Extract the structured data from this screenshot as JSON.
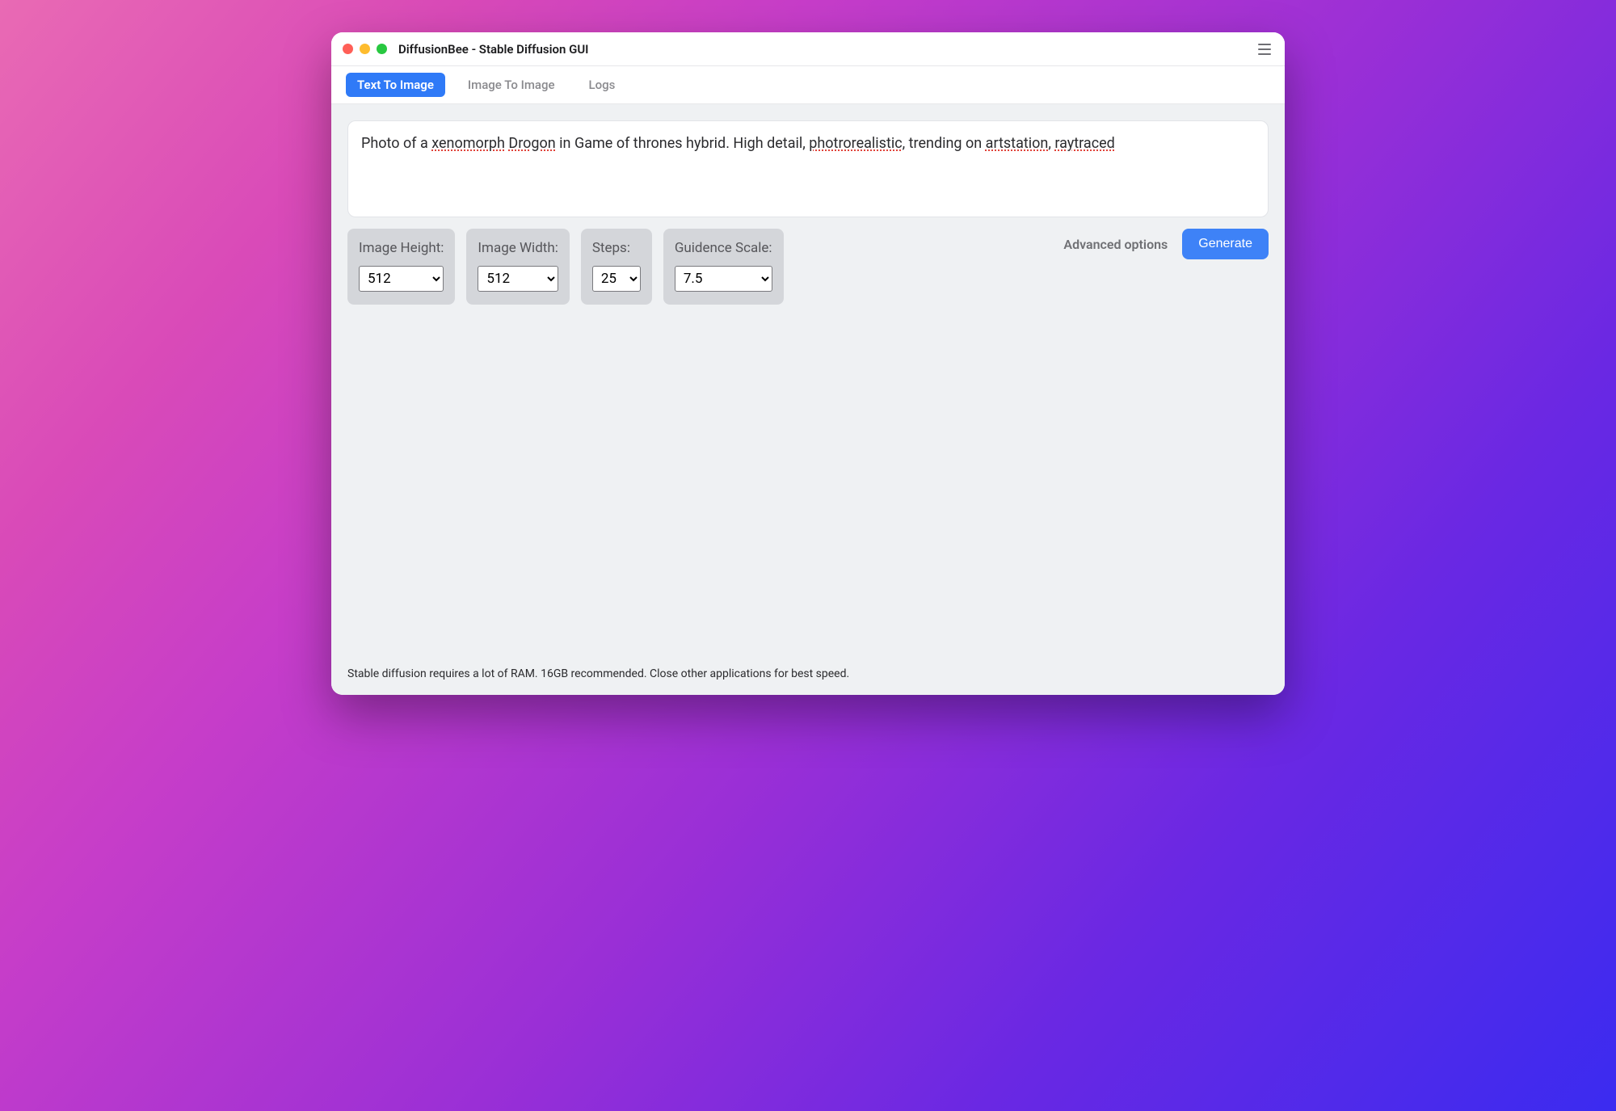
{
  "window": {
    "title": "DiffusionBee - Stable Diffusion GUI"
  },
  "tabs": {
    "text_to_image": "Text To Image",
    "image_to_image": "Image To Image",
    "logs": "Logs",
    "active": "text_to_image"
  },
  "prompt": {
    "value": "Photo of a xenomorph Drogon in Game of thrones hybrid. High detail, photrorealistic, trending on artstation, raytraced",
    "misspelled": [
      "xenomorph",
      "Drogon",
      "photrorealistic",
      "artstation",
      "raytraced"
    ]
  },
  "controls": {
    "image_height": {
      "label": "Image Height:",
      "value": "512"
    },
    "image_width": {
      "label": "Image Width:",
      "value": "512"
    },
    "steps": {
      "label": "Steps:",
      "value": "25"
    },
    "guidance": {
      "label": "Guidence Scale:",
      "value": "7.5"
    }
  },
  "actions": {
    "advanced_label": "Advanced options",
    "generate_label": "Generate"
  },
  "footer": {
    "text": "Stable diffusion requires a lot of RAM. 16GB recommended. Close other applications for best speed."
  }
}
